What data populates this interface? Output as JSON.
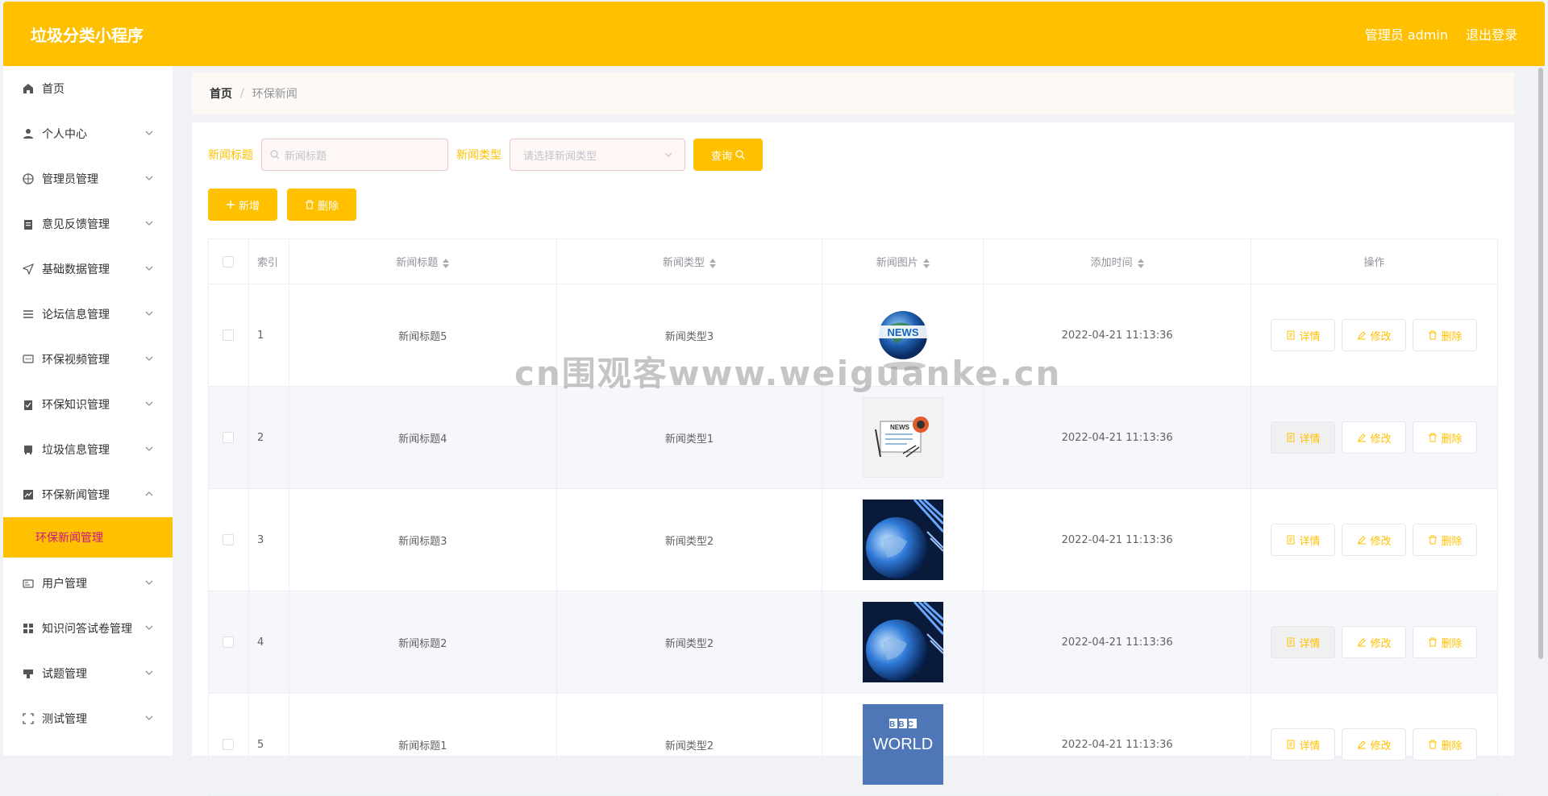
{
  "header": {
    "app_title": "垃圾分类小程序",
    "admin_label": "管理员 admin",
    "logout": "退出登录"
  },
  "sidebar": {
    "items": [
      {
        "label": "首页",
        "icon": "home-icon"
      },
      {
        "label": "个人中心",
        "icon": "user-icon"
      },
      {
        "label": "管理员管理",
        "icon": "globe-icon"
      },
      {
        "label": "意见反馈管理",
        "icon": "clipboard-icon"
      },
      {
        "label": "基础数据管理",
        "icon": "send-icon"
      },
      {
        "label": "论坛信息管理",
        "icon": "list-icon"
      },
      {
        "label": "环保视频管理",
        "icon": "chat-icon"
      },
      {
        "label": "环保知识管理",
        "icon": "check-clipboard-icon"
      },
      {
        "label": "垃圾信息管理",
        "icon": "box-icon"
      },
      {
        "label": "环保新闻管理",
        "icon": "chart-icon"
      },
      {
        "label": "用户管理",
        "icon": "id-card-icon"
      },
      {
        "label": "知识问答试卷管理",
        "icon": "grid-icon"
      },
      {
        "label": "试题管理",
        "icon": "stamp-icon"
      },
      {
        "label": "测试管理",
        "icon": "frame-icon"
      }
    ],
    "active_sub": "环保新闻管理"
  },
  "breadcrumb": {
    "home": "首页",
    "separator": "/",
    "current": "环保新闻"
  },
  "search": {
    "title_label": "新闻标题",
    "title_placeholder": "新闻标题",
    "type_label": "新闻类型",
    "type_placeholder": "请选择新闻类型",
    "query_button": "查询"
  },
  "actions": {
    "add": "新增",
    "delete": "删除"
  },
  "table": {
    "headers": {
      "index": "索引",
      "title": "新闻标题",
      "type": "新闻类型",
      "image": "新闻图片",
      "time": "添加时间",
      "ops": "操作"
    },
    "rows": [
      {
        "index": "1",
        "title": "新闻标题5",
        "type": "新闻类型3",
        "image": "globe-news-image",
        "time": "2022-04-21 11:13:36"
      },
      {
        "index": "2",
        "title": "新闻标题4",
        "type": "新闻类型1",
        "image": "newspaper-image",
        "time": "2022-04-21 11:13:36"
      },
      {
        "index": "3",
        "title": "新闻标题3",
        "type": "新闻类型2",
        "image": "blue-globe-image",
        "time": "2022-04-21 11:13:36"
      },
      {
        "index": "4",
        "title": "新闻标题2",
        "type": "新闻类型2",
        "image": "blue-globe-image",
        "time": "2022-04-21 11:13:36"
      },
      {
        "index": "5",
        "title": "新闻标题1",
        "type": "新闻类型2",
        "image": "bbc-world-image",
        "time": "2022-04-21 11:13:36"
      }
    ],
    "op_labels": {
      "detail": "详情",
      "edit": "修改",
      "delete": "删除"
    },
    "bbc_text_top": "BBC",
    "bbc_text_bottom": "WORLD"
  },
  "watermark": "cn围观客www.weiguanke.cn",
  "colors": {
    "accent": "#ffc000",
    "active_sub_text": "#c71585"
  }
}
